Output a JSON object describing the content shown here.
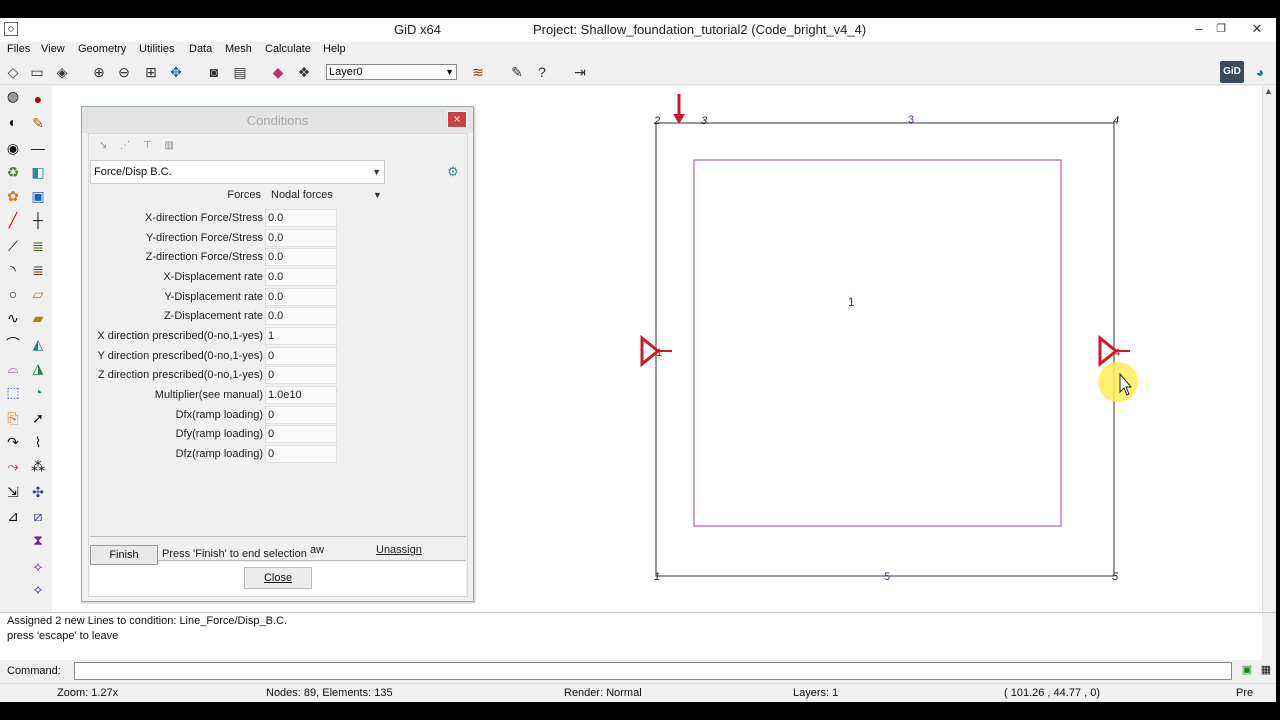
{
  "titlebar": {
    "app_icon": "gid-app-icon",
    "app_name": "GiD x64",
    "project_title": "Project: Shallow_foundation_tutorial2 (Code_bright_v4_4)",
    "minimize": "–",
    "restore": "❐",
    "close": "✕"
  },
  "menubar": {
    "items": [
      "Files",
      "View",
      "Geometry",
      "Utilities",
      "Data",
      "Mesh",
      "Calculate",
      "Help"
    ]
  },
  "toolbar": {
    "layer_value": "Layer0",
    "logo": "GiD"
  },
  "dialog": {
    "title": "Conditions",
    "close_glyph": "×",
    "tools": [
      "↘",
      "⋰",
      "⊤",
      "▥"
    ],
    "condition_selected": "Force/Disp B.C.",
    "forces_label": "Forces",
    "forces_value": "Nodal forces",
    "fields": [
      {
        "label": "X-direction Force/Stress",
        "value": "0.0"
      },
      {
        "label": "Y-direction Force/Stress",
        "value": "0.0"
      },
      {
        "label": "Z-direction Force/Stress",
        "value": "0.0"
      },
      {
        "label": "X-Displacement rate",
        "value": "0.0"
      },
      {
        "label": "Y-Displacement rate",
        "value": "0.0"
      },
      {
        "label": "Z-Displacement rate",
        "value": "0.0"
      },
      {
        "label": "X direction prescribed(0-no,1-yes)",
        "value": "1"
      },
      {
        "label": "Y direction prescribed(0-no,1-yes)",
        "value": "0"
      },
      {
        "label": "Z direction prescribed(0-no,1-yes)",
        "value": "0"
      },
      {
        "label": "Multiplier(see manual)",
        "value": "1.0e10"
      },
      {
        "label": "Dfx(ramp loading)",
        "value": "0"
      },
      {
        "label": "Dfy(ramp loading)",
        "value": "0"
      },
      {
        "label": "Dfz(ramp loading)",
        "value": "0"
      }
    ],
    "finish_label": "Finish",
    "finish_message": "Press 'Finish' to end selection",
    "draw_partial": "aw",
    "unassign_label": "Unassign",
    "close_label": "Close"
  },
  "canvas": {
    "point_labels": [
      "2",
      "3",
      "4",
      "1",
      "5"
    ],
    "line_labels": [
      "3",
      "5"
    ],
    "surface_label": "1",
    "left_marker_label": "1",
    "right_marker_label": "4"
  },
  "messages": [
    "Assigned 2 new Lines to condition: Line_Force/Disp_B.C.",
    "press 'escape' to leave"
  ],
  "command": {
    "label": "Command:",
    "value": ""
  },
  "status": {
    "zoom": "Zoom: 1.27x",
    "nodes": "Nodes: 89, Elements: 135",
    "render": "Render: Normal",
    "layers": "Layers: 1",
    "coords": "( 101.26 , 44.77 , 0)",
    "pre": "Pre"
  },
  "colors": {
    "accent_red": "#cc1a2a",
    "surface_magenta": "#b060b0",
    "label_red": "#8a1a3a",
    "cursor_highlight": "#ffee55"
  }
}
